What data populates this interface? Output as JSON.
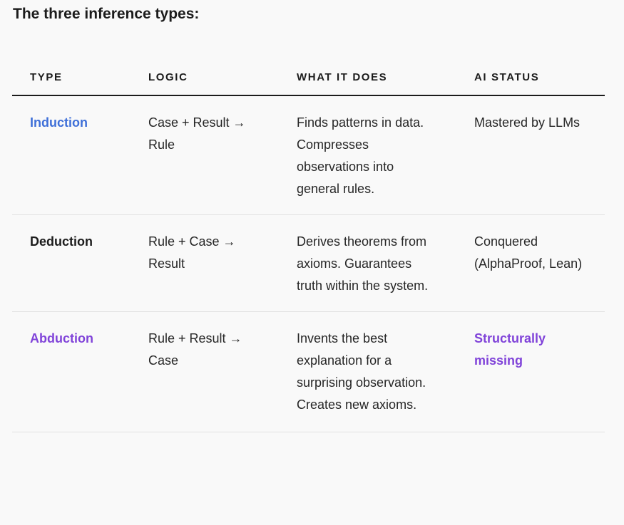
{
  "heading": "The three inference types:",
  "table": {
    "headers": {
      "type": "TYPE",
      "logic": "LOGIC",
      "does": "WHAT IT DOES",
      "status": "AI STATUS"
    },
    "rows": [
      {
        "type": "Induction",
        "logic": "Case + Result → Rule",
        "does": "Finds patterns in data. Compresses observations into general rules.",
        "status": "Mastered by LLMs"
      },
      {
        "type": "Deduction",
        "logic": "Rule + Case → Result",
        "does": "Derives theorems from axioms. Guarantees truth within the system.",
        "status": "Conquered (AlphaProof, Lean)"
      },
      {
        "type": "Abduction",
        "logic": "Rule + Result → Case",
        "does": "Invents the best explanation for a surprising observation. Creates new axioms.",
        "status": "Structurally missing"
      }
    ]
  },
  "colors": {
    "induction": "#3e6fd8",
    "deduction": "#1c1c1c",
    "abduction": "#8043d9"
  }
}
